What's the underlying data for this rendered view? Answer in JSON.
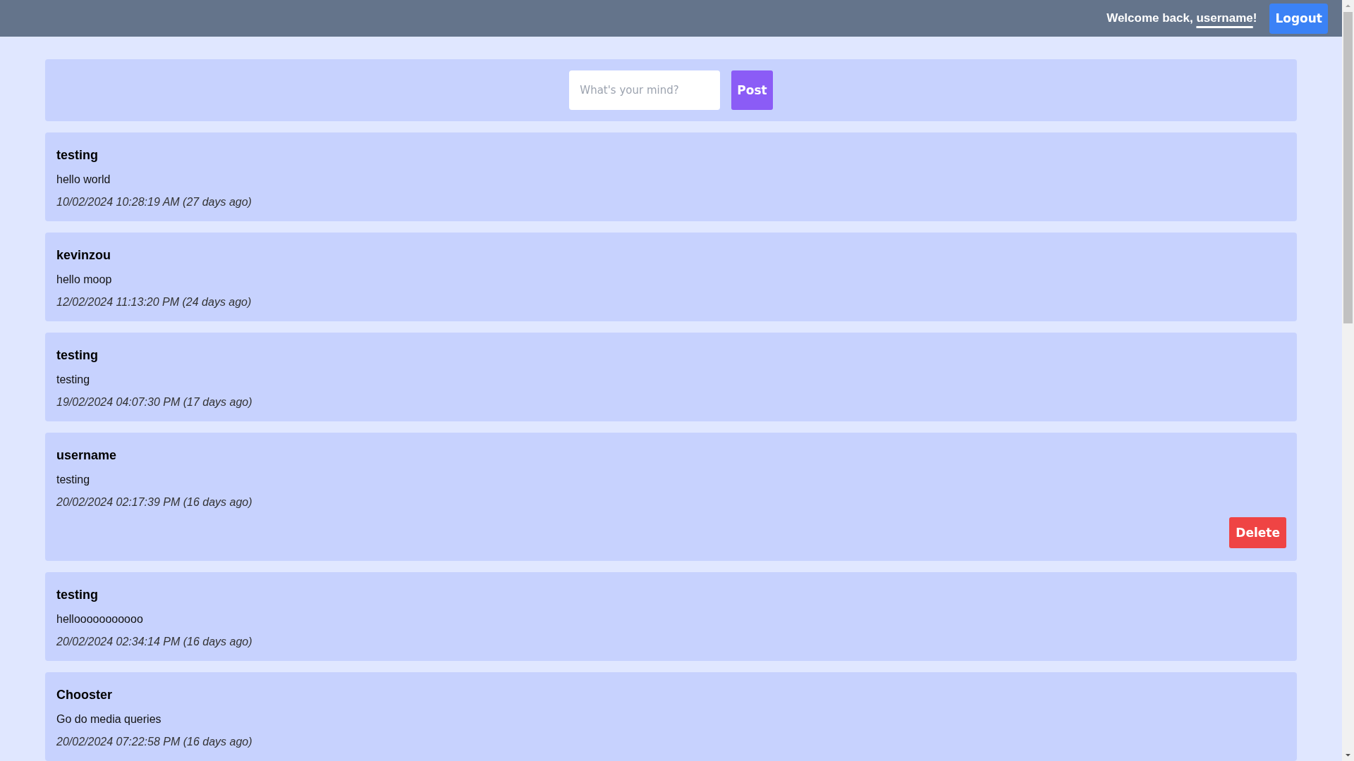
{
  "header": {
    "greeting_before": "Welcome back, ",
    "username": "username",
    "greeting_after": "!",
    "logout": "Logout"
  },
  "composer": {
    "placeholder": "What's your mind?",
    "button": "Post"
  },
  "posts": [
    {
      "author": "testing",
      "text": "hello world",
      "time": "10/02/2024 10:28:19 AM (27 days ago)",
      "can_delete": false
    },
    {
      "author": "kevinzou",
      "text": "hello moop",
      "time": "12/02/2024 11:13:20 PM (24 days ago)",
      "can_delete": false
    },
    {
      "author": "testing",
      "text": "testing",
      "time": "19/02/2024 04:07:30 PM (17 days ago)",
      "can_delete": false
    },
    {
      "author": "username",
      "text": "testing",
      "time": "20/02/2024 02:17:39 PM (16 days ago)",
      "can_delete": true,
      "delete_label": "Delete"
    },
    {
      "author": "testing",
      "text": "hellooooooooooo",
      "time": "20/02/2024 02:34:14 PM (16 days ago)",
      "can_delete": false
    },
    {
      "author": "Chooster",
      "text": "Go do media queries",
      "time": "20/02/2024 07:22:58 PM (16 days ago)",
      "can_delete": false
    }
  ]
}
